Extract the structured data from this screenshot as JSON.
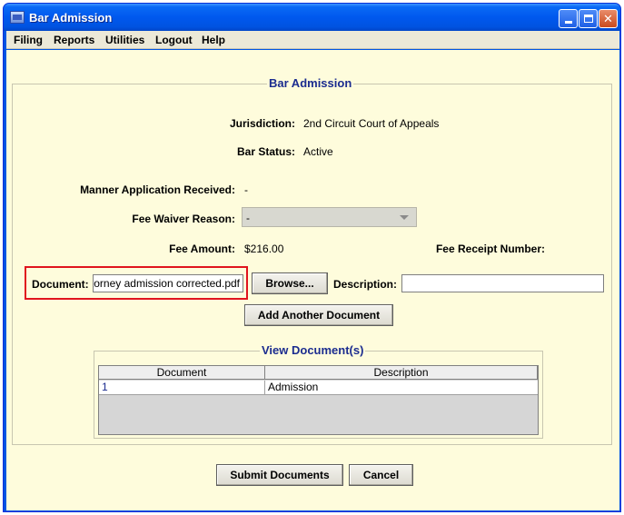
{
  "window": {
    "title": "Bar Admission"
  },
  "menu": [
    "Filing",
    "Reports",
    "Utilities",
    "Logout",
    "Help"
  ],
  "section": {
    "title": "Bar Admission"
  },
  "fields": {
    "jurisdiction_label": "Jurisdiction:",
    "jurisdiction_value": "2nd Circuit Court of Appeals",
    "bar_status_label": "Bar Status:",
    "bar_status_value": "Active",
    "manner_label": "Manner Application Received:",
    "manner_value": "-",
    "fee_waiver_label": "Fee Waiver Reason:",
    "fee_waiver_value": "-",
    "fee_amount_label": "Fee Amount:",
    "fee_amount_value": "$216.00",
    "fee_receipt_label": "Fee Receipt Number:",
    "document_label": "Document:",
    "document_value": "attorney admission corrected.pdf",
    "description_label": "Description:",
    "description_value": ""
  },
  "buttons": {
    "browse": "Browse...",
    "add_another": "Add Another Document",
    "submit": "Submit Documents",
    "cancel": "Cancel"
  },
  "view_documents": {
    "title": "View Document(s)",
    "columns": [
      "Document",
      "Description"
    ],
    "rows": [
      {
        "document": "1",
        "description": "Admission"
      }
    ]
  },
  "colors": {
    "accent": "#1b2c8f",
    "highlight": "#e0141e",
    "panel_bg": "#fefcdc",
    "titlebar": "#0058ee"
  }
}
